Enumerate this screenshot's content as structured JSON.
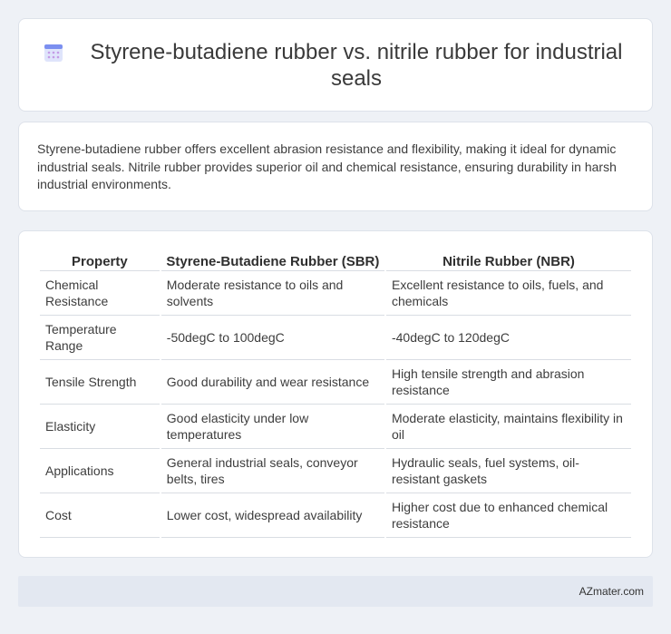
{
  "header": {
    "title": "Styrene-butadiene rubber vs. nitrile rubber for industrial seals",
    "icon": "calendar-icon"
  },
  "summary": {
    "text": "Styrene-butadiene rubber offers excellent abrasion resistance and flexibility, making it ideal for dynamic industrial seals. Nitrile rubber provides superior oil and chemical resistance, ensuring durability in harsh industrial environments."
  },
  "table": {
    "headers": [
      "Property",
      "Styrene-Butadiene Rubber (SBR)",
      "Nitrile Rubber (NBR)"
    ],
    "rows": [
      [
        "Chemical Resistance",
        "Moderate resistance to oils and solvents",
        "Excellent resistance to oils, fuels, and chemicals"
      ],
      [
        "Temperature Range",
        "-50degC to 100degC",
        "-40degC to 120degC"
      ],
      [
        "Tensile Strength",
        "Good durability and wear resistance",
        "High tensile strength and abrasion resistance"
      ],
      [
        "Elasticity",
        "Good elasticity under low temperatures",
        "Moderate elasticity, maintains flexibility in oil"
      ],
      [
        "Applications",
        "General industrial seals, conveyor belts, tires",
        "Hydraulic seals, fuel systems, oil-resistant gaskets"
      ],
      [
        "Cost",
        "Lower cost, widespread availability",
        "Higher cost due to enhanced chemical resistance"
      ]
    ]
  },
  "footer": {
    "site": "AZmater.com"
  },
  "colors": {
    "background": "#eef1f6",
    "footer_bg": "#e3e8f1",
    "icon_accent": "#7b8ff0"
  }
}
